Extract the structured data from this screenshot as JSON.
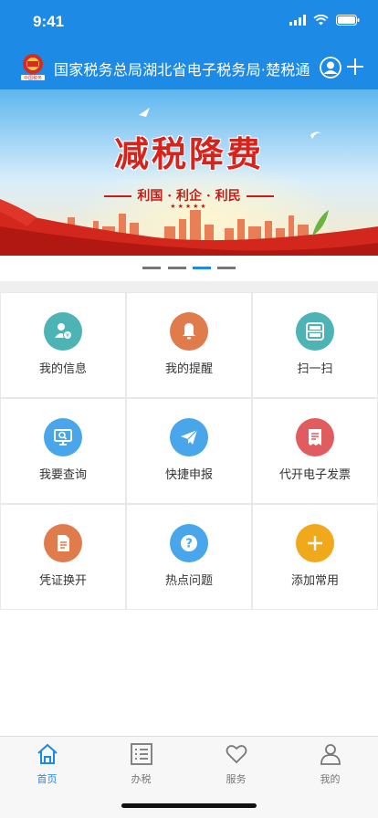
{
  "status_bar": {
    "time": "9:41"
  },
  "header": {
    "title": "国家税务总局湖北省电子税务局·楚税通",
    "logo_icon": "tax-emblem-icon",
    "user_icon": "user-icon",
    "add_icon": "plus-icon"
  },
  "banner": {
    "title": "减税降费",
    "subtitle_left": "利国",
    "subtitle_mid": "利企",
    "subtitle_right": "利民",
    "stars": "★★★★★",
    "page_count": 4,
    "active_page": 3
  },
  "grid": {
    "items": [
      {
        "label": "我的信息",
        "icon": "user-info-icon",
        "color": "#4eb3b5"
      },
      {
        "label": "我的提醒",
        "icon": "bell-icon",
        "color": "#e07c4c"
      },
      {
        "label": "扫一扫",
        "icon": "scan-icon",
        "color": "#4eb3b5"
      },
      {
        "label": "我要查询",
        "icon": "query-monitor-icon",
        "color": "#4aa6ea"
      },
      {
        "label": "快捷申报",
        "icon": "paper-plane-icon",
        "color": "#4aa6ea"
      },
      {
        "label": "代开电子发票",
        "icon": "invoice-icon",
        "color": "#e05c5e"
      },
      {
        "label": "凭证换开",
        "icon": "document-icon",
        "color": "#e07c4c"
      },
      {
        "label": "热点问题",
        "icon": "question-icon",
        "color": "#4aa6ea"
      },
      {
        "label": "添加常用",
        "icon": "add-icon",
        "color": "#f0a91a"
      }
    ]
  },
  "tabbar": {
    "tabs": [
      {
        "label": "首页",
        "icon": "home-icon",
        "active": true
      },
      {
        "label": "办税",
        "icon": "list-icon",
        "active": false
      },
      {
        "label": "服务",
        "icon": "heart-icon",
        "active": false
      },
      {
        "label": "我的",
        "icon": "profile-icon",
        "active": false
      }
    ]
  },
  "colors": {
    "primary": "#1d8ae5",
    "banner_red": "#d7231b"
  }
}
